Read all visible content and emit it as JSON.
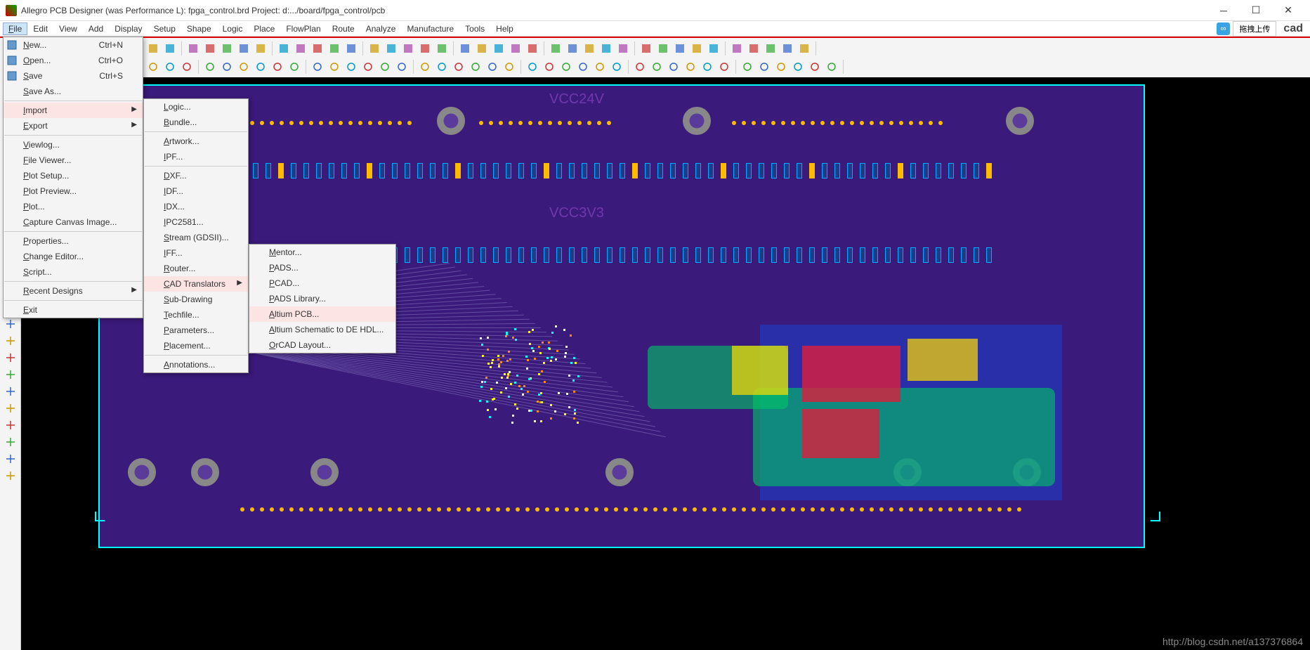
{
  "title": "Allegro PCB Designer (was Performance L): fpga_control.brd  Project: d:.../board/fpga_control/pcb",
  "menubar": [
    "File",
    "Edit",
    "View",
    "Add",
    "Display",
    "Setup",
    "Shape",
    "Logic",
    "Place",
    "FlowPlan",
    "Route",
    "Analyze",
    "Manufacture",
    "Tools",
    "Help"
  ],
  "file_menu": {
    "items": [
      {
        "label": "New...",
        "sc": "Ctrl+N",
        "icon": "new"
      },
      {
        "label": "Open...",
        "sc": "Ctrl+O",
        "icon": "open"
      },
      {
        "label": "Save",
        "sc": "Ctrl+S",
        "icon": "save"
      },
      {
        "label": "Save As..."
      },
      {
        "sep": true
      },
      {
        "label": "Import",
        "hl": true,
        "sub": true
      },
      {
        "label": "Export",
        "sub": true
      },
      {
        "sep": true
      },
      {
        "label": "Viewlog..."
      },
      {
        "label": "File Viewer..."
      },
      {
        "label": "Plot Setup..."
      },
      {
        "label": "Plot Preview..."
      },
      {
        "label": "Plot..."
      },
      {
        "label": "Capture Canvas Image..."
      },
      {
        "sep": true
      },
      {
        "label": "Properties..."
      },
      {
        "label": "Change Editor..."
      },
      {
        "label": "Script..."
      },
      {
        "sep": true
      },
      {
        "label": "Recent Designs",
        "sub": true
      },
      {
        "sep": true
      },
      {
        "label": "Exit"
      }
    ]
  },
  "import_menu": {
    "items": [
      {
        "label": "Logic..."
      },
      {
        "label": "Bundle..."
      },
      {
        "sep": true
      },
      {
        "label": "Artwork..."
      },
      {
        "label": "IPF..."
      },
      {
        "sep": true
      },
      {
        "label": "DXF..."
      },
      {
        "label": "IDF..."
      },
      {
        "label": "IDX..."
      },
      {
        "label": "IPC2581..."
      },
      {
        "label": "Stream (GDSII)..."
      },
      {
        "label": "IFF..."
      },
      {
        "label": "Router..."
      },
      {
        "label": "CAD Translators",
        "hl": true,
        "sub": true
      },
      {
        "label": "Sub-Drawing"
      },
      {
        "label": "Techfile..."
      },
      {
        "label": "Parameters..."
      },
      {
        "label": "Placement..."
      },
      {
        "sep": true
      },
      {
        "label": "Annotations..."
      }
    ]
  },
  "cad_menu": {
    "items": [
      {
        "label": "Mentor..."
      },
      {
        "label": "PADS..."
      },
      {
        "label": "PCAD..."
      },
      {
        "label": "PADS Library..."
      },
      {
        "label": "Altium PCB...",
        "hl": true
      },
      {
        "label": "Altium Schematic to DE HDL..."
      },
      {
        "label": "OrCAD Layout..."
      }
    ]
  },
  "pcb_labels": {
    "vcc24v": "VCC24V",
    "vcc3v3": "VCC3V3"
  },
  "watermark": {
    "upload": "拖拽上传",
    "cad": "cad"
  },
  "footer": "http://blog.csdn.net/a137376864",
  "colors": {
    "accent": "#3a1a7a",
    "highlight": "#fde4e4"
  }
}
